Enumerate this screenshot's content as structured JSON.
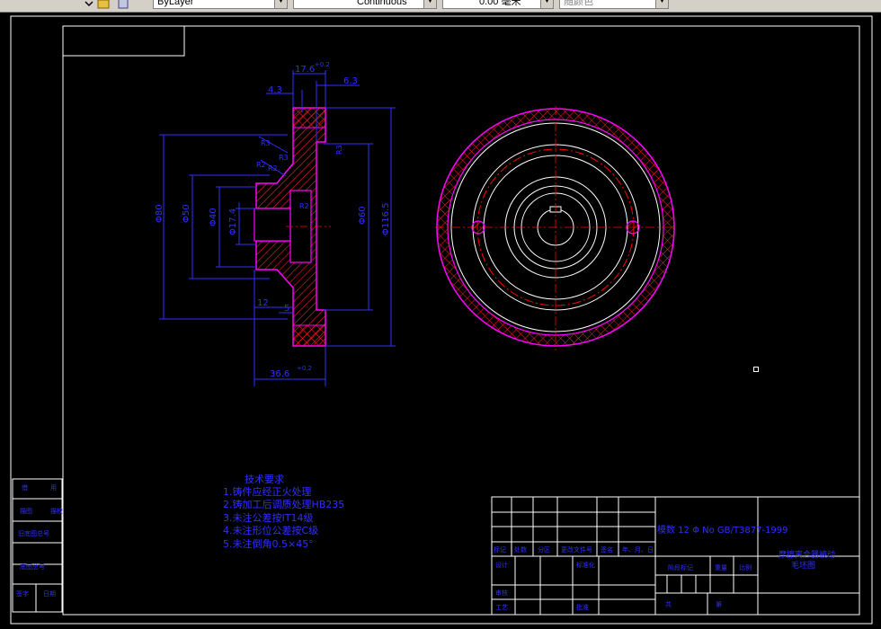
{
  "toolbar": {
    "layer_value": "ByLayer",
    "linetype_value": "Continuous",
    "lineweight_value": "0.00 毫米",
    "color_value": "随颜色"
  },
  "drawing": {
    "dims": {
      "d_17_6": "17.6",
      "tol_top": "+0.2",
      "d_6_3": "6.3",
      "d_4_3": "4.3",
      "r3_a": "R3",
      "r2_a": "R2",
      "r2_b": "R2",
      "r3_b": "R3",
      "r3_c": "R3",
      "r2_c": "R2",
      "phi80": "Φ80",
      "phi50": "Φ50",
      "phi40": "Φ40",
      "phi17_4": "Φ17.4",
      "phi60": "Φ60",
      "phi116_5": "Φ116.5",
      "d_12": "12",
      "d_5": "5",
      "d_36_6": "36.6",
      "tol_bottom": "+0.2"
    },
    "notes": {
      "title": "技术要求",
      "lines": [
        "1.铸件应经正火处理",
        "2.铸加工后调质处理HB235",
        "3.未注公差按IT14级",
        "4.未注形位公差按C级",
        "5.未注倒角0.5×45°"
      ]
    },
    "title_block": {
      "standard": "模数 12 Φ No GB/T3877-1999",
      "part_name_1": "摩擦离合器被动",
      "part_name_2": "毛坯图",
      "hdr": [
        "标记",
        "处数",
        "分区",
        "更改文件号",
        "签名",
        "年、月、日"
      ],
      "row_design": "设计",
      "row_std": "标准化",
      "row_check": "审核",
      "row_craft": "工艺",
      "row_approve": "批准",
      "stage": "阶段标记",
      "weight": "重量",
      "scale": "比例",
      "sheet_total": "共",
      "sheet_num": "第"
    },
    "side_table": [
      "借",
      "用",
      "描图",
      "描校",
      "旧底图总号",
      "底图总号",
      "签字",
      "日期"
    ]
  },
  "colors": {
    "border": "#ffffff",
    "dimension": "#3030ff",
    "outline": "#ff00ff",
    "hatch": "#ff2020",
    "centerline": "#ff0000"
  }
}
